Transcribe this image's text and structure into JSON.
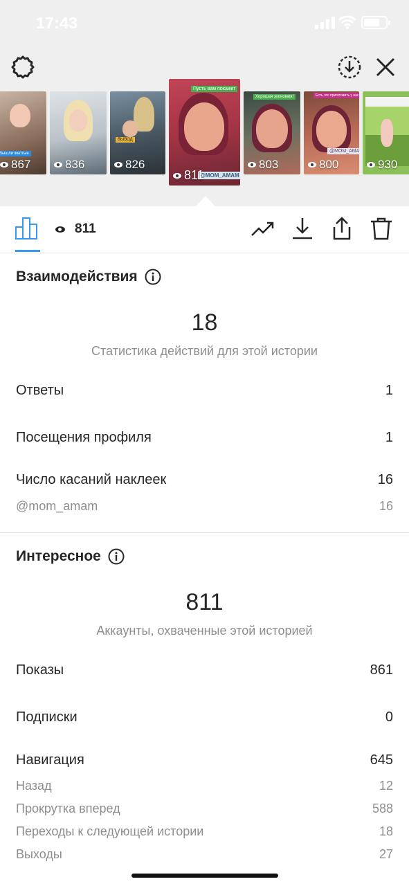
{
  "status_bar": {
    "time": "17:43"
  },
  "stories": [
    {
      "views": "867"
    },
    {
      "views": "836"
    },
    {
      "views": "826"
    },
    {
      "views": "811",
      "selected": true,
      "caption_top": "Пусть вам покажет",
      "caption_badge": "@MOM_AMAM"
    },
    {
      "views": "803",
      "caption_top": "Хорошая экономия!"
    },
    {
      "views": "800",
      "caption_top": "Есть что приготовить у нас на странице",
      "caption_badge": "@MOM_AMAM"
    },
    {
      "views": "930"
    }
  ],
  "toolbar": {
    "views": "811",
    "icons": [
      "bar-chart-icon",
      "trend-icon",
      "download-icon",
      "share-icon",
      "trash-icon"
    ]
  },
  "interactions": {
    "title": "Взаимодействия",
    "total": "18",
    "subtitle": "Статистика действий для этой истории",
    "rows": [
      {
        "label": "Ответы",
        "value": "1"
      },
      {
        "label": "Посещения профиля",
        "value": "1"
      },
      {
        "label": "Число касаний наклеек",
        "value": "16"
      }
    ],
    "sticker_rows": [
      {
        "label": "@mom_amam",
        "value": "16"
      }
    ]
  },
  "discovery": {
    "title": "Интересное",
    "total": "811",
    "subtitle": "Аккаунты, охваченные этой историей",
    "rows": [
      {
        "label": "Показы",
        "value": "861"
      },
      {
        "label": "Подписки",
        "value": "0"
      },
      {
        "label": "Навигация",
        "value": "645"
      }
    ],
    "navigation_rows": [
      {
        "label": "Назад",
        "value": "12"
      },
      {
        "label": "Прокрутка вперед",
        "value": "588"
      },
      {
        "label": "Переходы к следующей истории",
        "value": "18"
      },
      {
        "label": "Выходы",
        "value": "27"
      }
    ]
  },
  "colors": {
    "accent": "#3897f0",
    "text": "#262626",
    "muted": "#8e8e8e",
    "top_bg": "#efefef"
  }
}
